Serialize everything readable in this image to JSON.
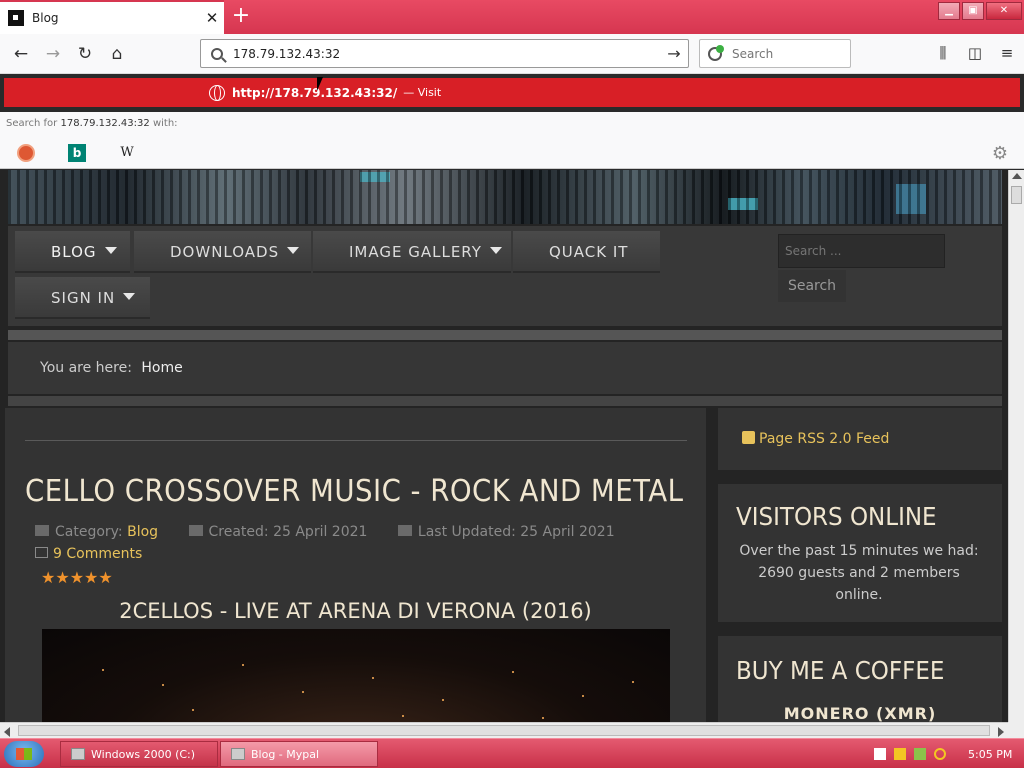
{
  "browser": {
    "tab_title": "Blog",
    "tab_close": "✕",
    "new_tab": "+",
    "url": "178.79.132.43:32",
    "search_placeholder": "Search",
    "suggestion": {
      "url": "http://178.79.132.43:32/",
      "visit": "— Visit"
    },
    "search_with_prefix": "Search for",
    "search_with_term": "178.79.132.43:32",
    "search_with_suffix": "with:",
    "engines": [
      "DuckDuckGo",
      "Bing",
      "Wikipedia"
    ],
    "engine_glyphs": {
      "duck": "",
      "bing": "b",
      "wiki": "W"
    }
  },
  "site": {
    "menu": [
      {
        "label": "BLOG",
        "dropdown": true,
        "active": true
      },
      {
        "label": "DOWNLOADS",
        "dropdown": true
      },
      {
        "label": "IMAGE GALLERY",
        "dropdown": true
      },
      {
        "label": "QUACK IT",
        "dropdown": false
      },
      {
        "label": "SIGN IN",
        "dropdown": true
      }
    ],
    "search_placeholder": "Search ...",
    "search_button": "Search",
    "breadcrumb": {
      "prefix": "You are here:",
      "current": "Home"
    },
    "article": {
      "title": "CELLO CROSSOVER MUSIC - ROCK AND METAL",
      "category_label": "Category:",
      "category": "Blog",
      "created": "Created: 25 April 2021",
      "updated": "Last Updated: 25 April 2021",
      "comments": "9 Comments",
      "rating": "★★★★★",
      "subtitle": "2CELLOS - LIVE AT ARENA DI VERONA (2016)"
    },
    "sidebar": {
      "rss": "Page RSS 2.0 Feed",
      "visitors_title": "VISITORS ONLINE",
      "visitors_text": "Over the past 15 minutes we had: 2690 guests and 2 members online.",
      "coffee_title": "BUY ME A COFFEE",
      "coffee_sub": "MONERO (XMR)"
    }
  },
  "taskbar": {
    "tasks": [
      "Windows 2000 (C:)",
      "Blog - Mypal"
    ],
    "clock": "5:05 PM"
  },
  "colors": {
    "accent": "#d81f26",
    "link": "#e7c25b",
    "heading": "#f0e6d0",
    "taskbar": "#d63650"
  }
}
